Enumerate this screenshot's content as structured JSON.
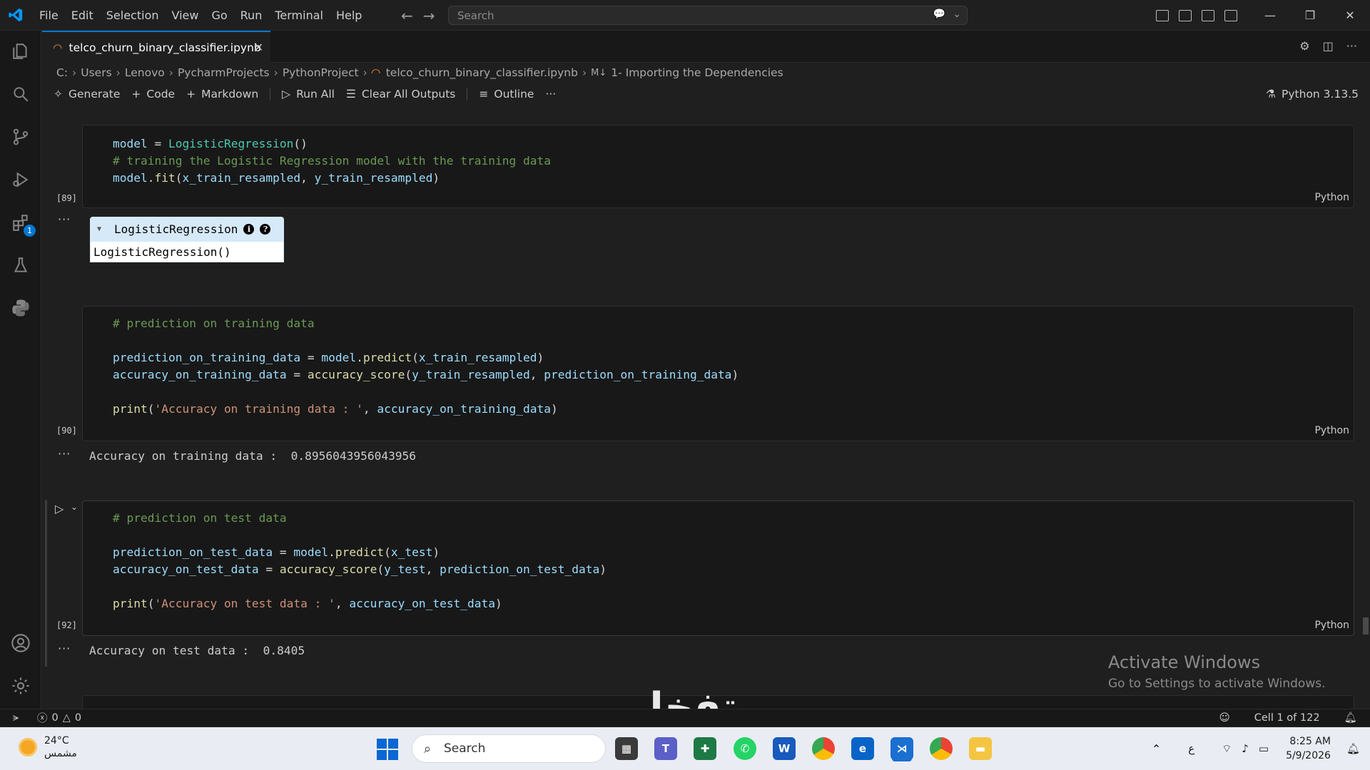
{
  "titlebar": {
    "menus": [
      "File",
      "Edit",
      "Selection",
      "View",
      "Go",
      "Run",
      "Terminal",
      "Help"
    ],
    "search_placeholder": "Search"
  },
  "tab": {
    "filename": "telco_churn_binary_classifier.ipynb"
  },
  "breadcrumb": {
    "parts": [
      "C:",
      "Users",
      "Lenovo",
      "PycharmProjects",
      "PythonProject"
    ],
    "file": "telco_churn_binary_classifier.ipynb",
    "section": "1- Importing the Dependencies"
  },
  "toolbar": {
    "generate": "Generate",
    "code": "Code",
    "markdown": "Markdown",
    "run_all": "Run All",
    "clear_outputs": "Clear All Outputs",
    "outline": "Outline",
    "kernel": "Python 3.13.5"
  },
  "cells": [
    {
      "exec_count": "[89]",
      "lang": "Python",
      "widget_name": "LogisticRegression",
      "widget_repr": "LogisticRegression()"
    },
    {
      "exec_count": "[90]",
      "lang": "Python",
      "output": "Accuracy on training data :  0.8956043956043956"
    },
    {
      "exec_count": "[92]",
      "lang": "Python",
      "output": "Accuracy on test data :  0.8405"
    }
  ],
  "activate": {
    "title": "Activate Windows",
    "subtitle": "Go to Settings to activate Windows."
  },
  "watermark": "تفخلي",
  "statusbar": {
    "errors": "0",
    "warnings": "0",
    "cell_position": "Cell 1 of 122"
  },
  "taskbar": {
    "temperature": "24°C",
    "condition": "مشمس",
    "search": "Search",
    "lang": "ع",
    "time": "8:25 AM",
    "date": "5/9/2026"
  },
  "colors": {
    "accent": "#0078d4",
    "notebook_icon": "#f28b30"
  }
}
